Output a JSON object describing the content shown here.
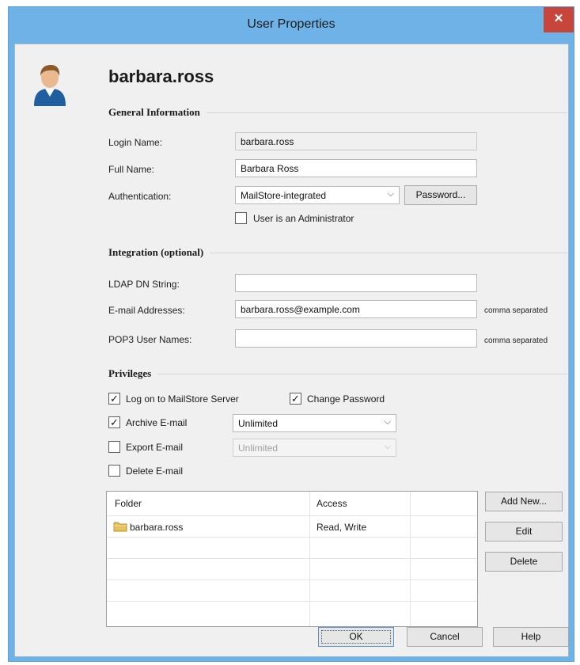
{
  "window": {
    "title": "User Properties",
    "close_glyph": "✕"
  },
  "user": {
    "display_name": "barbara.ross",
    "avatar_icon": "user-avatar-icon"
  },
  "general": {
    "section_title": "General Information",
    "login_name_label": "Login Name:",
    "login_name_value": "barbara.ross",
    "full_name_label": "Full Name:",
    "full_name_value": "Barbara Ross",
    "authentication_label": "Authentication:",
    "authentication_value": "MailStore-integrated",
    "password_button": "Password...",
    "admin_checkbox_label": "User is an Administrator",
    "admin_checked": false
  },
  "integration": {
    "section_title": "Integration (optional)",
    "ldap_label": "LDAP DN String:",
    "ldap_value": "",
    "email_label": "E-mail Addresses:",
    "email_value": "barbara.ross@example.com",
    "email_note": "comma separated",
    "pop3_label": "POP3 User Names:",
    "pop3_value": "",
    "pop3_note": "comma separated"
  },
  "privileges": {
    "section_title": "Privileges",
    "logon_label": "Log on to MailStore Server",
    "logon_checked": true,
    "change_password_label": "Change Password",
    "change_password_checked": true,
    "archive_label": "Archive E-mail",
    "archive_checked": true,
    "archive_option": "Unlimited",
    "export_label": "Export E-mail",
    "export_checked": false,
    "export_option": "Unlimited",
    "delete_label": "Delete E-mail",
    "delete_checked": false
  },
  "folders": {
    "columns": [
      "Folder",
      "Access"
    ],
    "rows": [
      {
        "folder": "barbara.ross",
        "access": "Read, Write",
        "icon": "folder-icon"
      }
    ],
    "add_button": "Add New...",
    "edit_button": "Edit",
    "delete_button": "Delete"
  },
  "footer": {
    "ok_button": "OK",
    "cancel_button": "Cancel",
    "help_button": "Help"
  },
  "colors": {
    "title_bar": "#6fb2e8",
    "close_button": "#c7453a",
    "dialog_background": "#f0f0f0"
  }
}
